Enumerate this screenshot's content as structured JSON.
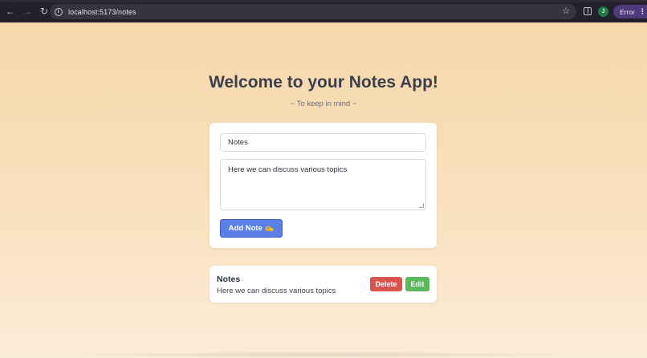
{
  "browser": {
    "back_icon": "arrow-left-icon",
    "forward_icon": "arrow-right-icon",
    "reload_icon": "reload-icon",
    "url": "localhost:5173/notes",
    "bookmark_icon": "star-icon",
    "profile_initial": "J",
    "error_label": "Error",
    "menu_icon": "more-vert-icon"
  },
  "page": {
    "title": "Welcome to your Notes App!",
    "subtitle": "~ To keep in mind ~"
  },
  "form": {
    "title_value": "Notes",
    "body_value": "Here we can discuss various topics",
    "add_button_label": "Add Note ✍️"
  },
  "notes": [
    {
      "title": "Notes",
      "body": "Here we can discuss various topics",
      "delete_label": "Delete",
      "edit_label": "Edit"
    }
  ],
  "colors": {
    "accent": "#5a7fe6",
    "delete": "#d9534f",
    "edit": "#5cb85c",
    "background": "#f6d9ad"
  }
}
